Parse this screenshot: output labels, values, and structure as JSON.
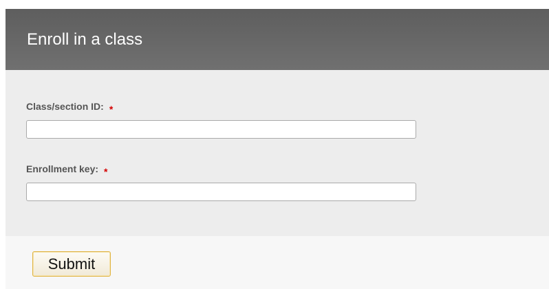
{
  "form": {
    "title": "Enroll in a class",
    "fields": [
      {
        "label": "Class/section ID:",
        "required_mark": "*",
        "value": "",
        "placeholder": ""
      },
      {
        "label": "Enrollment key:",
        "required_mark": "*",
        "value": "",
        "placeholder": ""
      }
    ],
    "submit_label": "Submit"
  },
  "colors": {
    "header_bg": "#666666",
    "body_bg": "#ededed",
    "footer_bg": "#f7f7f7",
    "required": "#d40000",
    "button_border": "#e0b443"
  }
}
